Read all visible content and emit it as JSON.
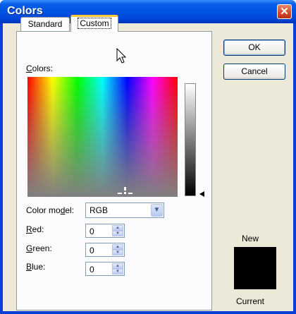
{
  "window": {
    "title": "Colors",
    "close_glyph": "✕"
  },
  "tabs": [
    {
      "label": "Standard",
      "active": false
    },
    {
      "label": "Custom",
      "active": true
    }
  ],
  "custom": {
    "colors_label": "Colors:",
    "color_model_label": "Color model:",
    "color_model_value": "RGB",
    "red_label": "Red:",
    "red_value": "0",
    "green_label": "Green:",
    "green_value": "0",
    "blue_label": "Blue:",
    "blue_value": "0"
  },
  "buttons": {
    "ok": "OK",
    "cancel": "Cancel"
  },
  "preview": {
    "new_label": "New",
    "current_label": "Current",
    "new_color": "#000000",
    "current_color": "#000000"
  },
  "icons": {
    "dropdown": "chevron-down-icon",
    "spin_up": "triangle-up-icon",
    "spin_down": "triangle-down-icon",
    "pointer": "mouse-pointer-icon"
  }
}
